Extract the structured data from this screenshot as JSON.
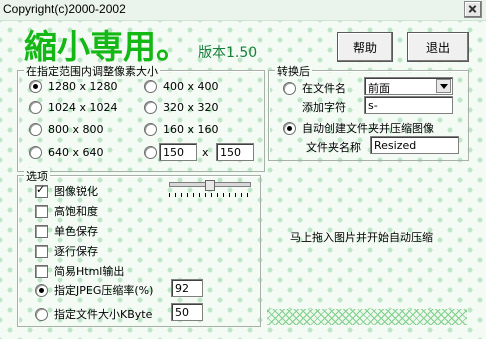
{
  "window": {
    "title": "Copyright(c)2000-2002"
  },
  "header": {
    "logo_text": "縮小専用。",
    "version": "版本1.50"
  },
  "buttons": {
    "help": "帮助",
    "exit": "退出"
  },
  "size_group": {
    "title": "在指定范围内调整像素大小",
    "presets": [
      {
        "label": "1280 x 1280",
        "selected": true
      },
      {
        "label": "400 x 400",
        "selected": false
      },
      {
        "label": "1024 x 1024",
        "selected": false
      },
      {
        "label": "320 x 320",
        "selected": false
      },
      {
        "label": "800 x 800",
        "selected": false
      },
      {
        "label": "160 x 160",
        "selected": false
      },
      {
        "label": "640 x 640",
        "selected": false
      }
    ],
    "custom": {
      "width": "150",
      "separator": "x",
      "height": "150",
      "selected": false
    }
  },
  "convert_group": {
    "title": "转换后",
    "prefix_option": {
      "label": "在文件名",
      "selected": false
    },
    "position_select": {
      "value": "前面"
    },
    "add_char": {
      "label": "添加字符",
      "value": "s-"
    },
    "folder_option": {
      "label": "自动创建文件夹并压缩图像",
      "selected": true
    },
    "folder_name": {
      "label": "文件夹名称",
      "value": "Resized"
    }
  },
  "options_group": {
    "title": "选项",
    "checks": [
      {
        "label": "图像锐化",
        "checked": true
      },
      {
        "label": "高饱和度",
        "checked": false
      },
      {
        "label": "单色保存",
        "checked": false
      },
      {
        "label": "逐行保存",
        "checked": false
      },
      {
        "label": "简易Html输出",
        "checked": false
      }
    ],
    "jpeg_rate": {
      "label": "指定JPEG压缩率(%)",
      "value": "92",
      "selected": true
    },
    "file_size": {
      "label": "指定文件大小KByte",
      "value": "50",
      "selected": false
    }
  },
  "hint": "马上拖入图片并开始自动压缩",
  "colors": {
    "logo": "#14b814",
    "background": "#f4fbf5",
    "dot": "#bfe6c8"
  }
}
